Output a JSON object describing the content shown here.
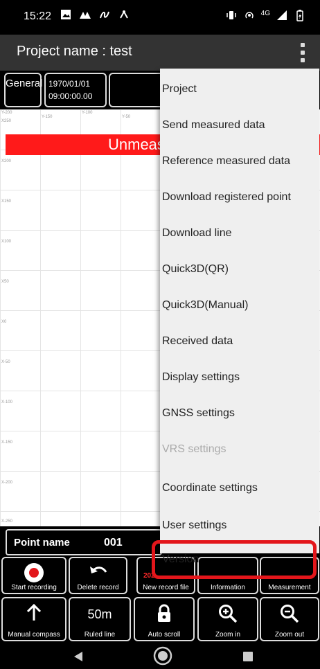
{
  "status_bar": {
    "time": "15:22",
    "network": "4G"
  },
  "app_bar": {
    "title": "Project name : test"
  },
  "info_row": {
    "mode": "General",
    "datetime_line1": "1970/01/01",
    "datetime_line2": "09:00:00.00"
  },
  "map": {
    "banner": "Unmeasured",
    "top_labels": [
      "Y-200",
      "Y-150",
      "Y-100",
      "Y-50"
    ],
    "left_labels": [
      "X250",
      "X200",
      "X150",
      "X100",
      "X50",
      "X0",
      "X-50",
      "X-100",
      "X-150",
      "X-200",
      "X-250"
    ]
  },
  "point": {
    "label": "Point name",
    "value": "001"
  },
  "buttons_row1": [
    "Start recording",
    "Delete record",
    "New record file",
    "Information",
    "Measurement"
  ],
  "buttons_row1_overlay": "202",
  "buttons_row2": [
    "Manual compass",
    "Ruled line",
    "Auto scroll",
    "Zoom in",
    "Zoom out"
  ],
  "ruled_line_value": "50m",
  "menu": {
    "items": [
      "Project",
      "Send measured data",
      "Reference measured data",
      "Download registered point",
      "Download line",
      "Quick3D(QR)",
      "Quick3D(Manual)",
      "Received data",
      "Display settings",
      "GNSS settings",
      "VRS settings",
      "Coordinate settings",
      "User settings",
      "Version"
    ]
  },
  "colors": {
    "accent_red": "#ff1a1a",
    "highlight_red": "#e3161b",
    "menu_bg": "#efefef"
  }
}
